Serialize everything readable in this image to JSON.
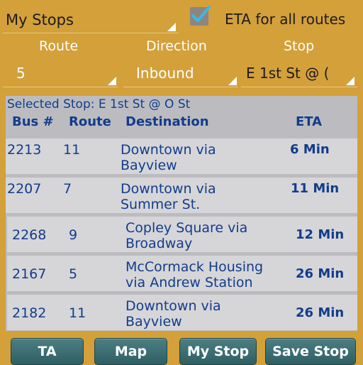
{
  "top": {
    "my_stops_label": "My Stops",
    "eta_all_routes_label": "ETA for all routes",
    "eta_all_routes_checked": true
  },
  "filters": {
    "route_header": "Route",
    "direction_header": "Direction",
    "stop_header": "Stop",
    "route_value": "5",
    "direction_value": "Inbound",
    "stop_value": "E 1st St @ ("
  },
  "table": {
    "selected_stop": "Selected Stop: E 1st St @ O St",
    "headers": {
      "bus": "Bus #",
      "route": "Route",
      "destination": "Destination",
      "eta": "ETA"
    },
    "rows": [
      {
        "bus": "2213",
        "route": "11",
        "dest1": "Downtown via",
        "dest2": "Bayview",
        "eta": "6 Min"
      },
      {
        "bus": "2207",
        "route": "7",
        "dest1": "Downtown via",
        "dest2": "Summer St.",
        "eta": "11 Min"
      },
      {
        "bus": "2268",
        "route": "9",
        "dest1": "Copley Square via",
        "dest2": "Broadway",
        "eta": "12 Min"
      },
      {
        "bus": "2167",
        "route": "5",
        "dest1": "McCormack Housing",
        "dest2": "via Andrew Station",
        "eta": "26 Min"
      },
      {
        "bus": "2182",
        "route": "11",
        "dest1": "Downtown via",
        "dest2": "Bayview",
        "eta": "26 Min"
      }
    ]
  },
  "buttons": {
    "ta": "TA",
    "map": "Map",
    "my_stop": "My Stop",
    "save_stop": "Save Stop"
  },
  "colors": {
    "background": "#d3a03a",
    "table_text": "#123c8c",
    "button": "#3d6e72",
    "checkbox_accent": "#3db7e4"
  }
}
